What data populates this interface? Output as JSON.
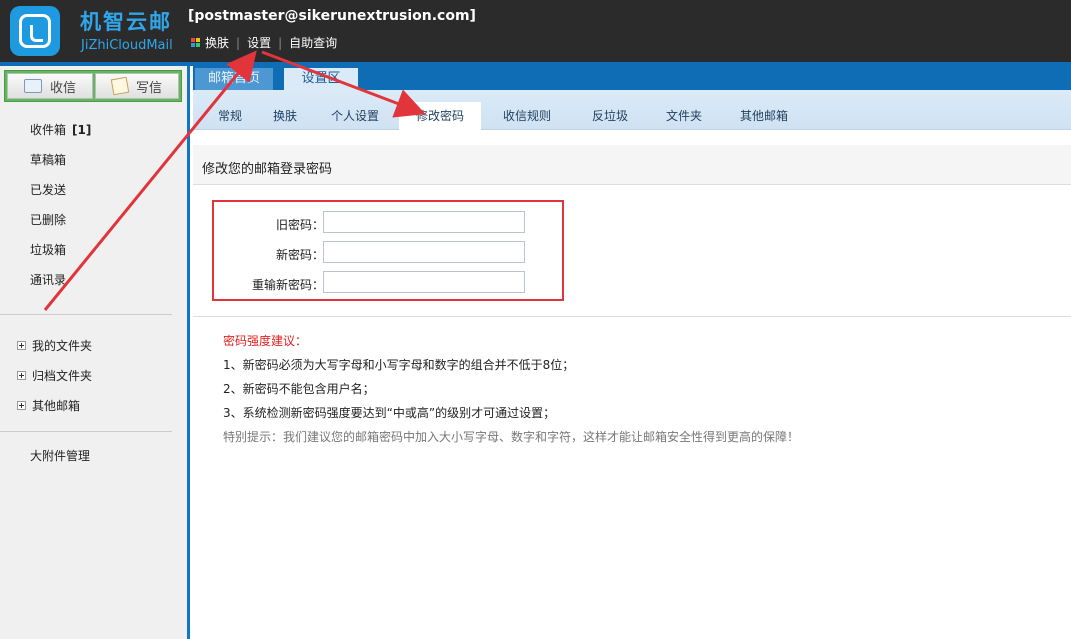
{
  "header": {
    "brand_cn": "机智云邮",
    "brand_en": "JiZhiCloudMail",
    "account": "[postmaster@sikerunextrusion.com]",
    "nav": [
      "换肤",
      "设置",
      "自助查询"
    ]
  },
  "sidebar": {
    "receive_label": "收信",
    "compose_label": "写信",
    "folders": [
      {
        "label": "收件箱",
        "count": "[1]"
      },
      {
        "label": "草稿箱"
      },
      {
        "label": "已发送"
      },
      {
        "label": "已删除"
      },
      {
        "label": "垃圾箱"
      },
      {
        "label": "通讯录"
      }
    ],
    "tree": [
      "我的文件夹",
      "归档文件夹",
      "其他邮箱"
    ],
    "attachments": "大附件管理"
  },
  "main_tabs": [
    "邮箱首页",
    "设置区"
  ],
  "sub_tabs": [
    "常规",
    "换肤",
    "个人设置",
    "修改密码",
    "收信规则",
    "反垃圾",
    "文件夹",
    "其他邮箱"
  ],
  "section_title": "修改您的邮箱登录密码",
  "form": {
    "old_label": "旧密码：",
    "new_label": "新密码：",
    "repeat_label": "重输新密码："
  },
  "tips": {
    "title": "密码强度建议：",
    "lines": [
      "1、新密码必须为大写字母和小写字母和数字的组合并不低于8位；",
      "2、新密码不能包含用户名；",
      "3、系统检测新密码强度要达到“中或高”的级别才可通过设置；"
    ],
    "note": "特别提示：我们建议您的邮箱密码中加入大小写字母、数字和字符，这样才能让邮箱安全性得到更高的保障！"
  },
  "colors": {
    "header_bg": "#2b2b2b",
    "brand": "#2fa6ea",
    "accent_blue": "#0f6db5",
    "annotation_red": "#e1343b"
  }
}
